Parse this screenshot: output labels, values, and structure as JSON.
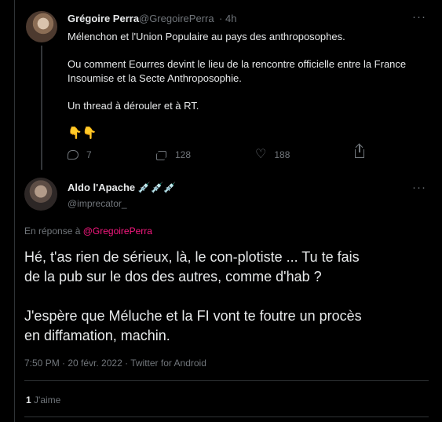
{
  "tweet1": {
    "name": "Grégoire Perra",
    "handle": "@GregoirePerra",
    "dot": "·",
    "time": "4h",
    "lines": [
      "Mélenchon et l'Union Populaire au pays des anthroposophes.",
      "Ou comment Eourres devint le lieu de la rencontre officielle entre la France",
      "Insoumise et la Secte Anthroposophie.",
      "Un thread à dérouler et à RT."
    ],
    "emoji": "👇👇",
    "actions": {
      "reply_count": "7",
      "retweet_count": "128",
      "like_count": "188"
    }
  },
  "tweet2": {
    "name": "Aldo l'Apache 💉💉💉",
    "handle": "@imprecator_",
    "reply_prefix": "En réponse à",
    "reply_handle": "@GregoirePerra",
    "text_lines": [
      "Hé, t'as rien de sérieux, là, le con-plotiste ... Tu te fais",
      "de la pub sur le dos des autres, comme d'hab ?",
      "J'espère que Méluche et la FI vont te foutre un procès",
      "en diffamation, machin."
    ],
    "meta": "7:50 PM · 20 févr. 2022 · Twitter for Android",
    "likes_count": "1",
    "likes_label": "J'aime"
  },
  "ui": {
    "more": "···",
    "icons": {
      "reply": "reply-icon",
      "retweet": "retweet-icon",
      "like": "heart-icon",
      "share": "share-icon"
    }
  }
}
